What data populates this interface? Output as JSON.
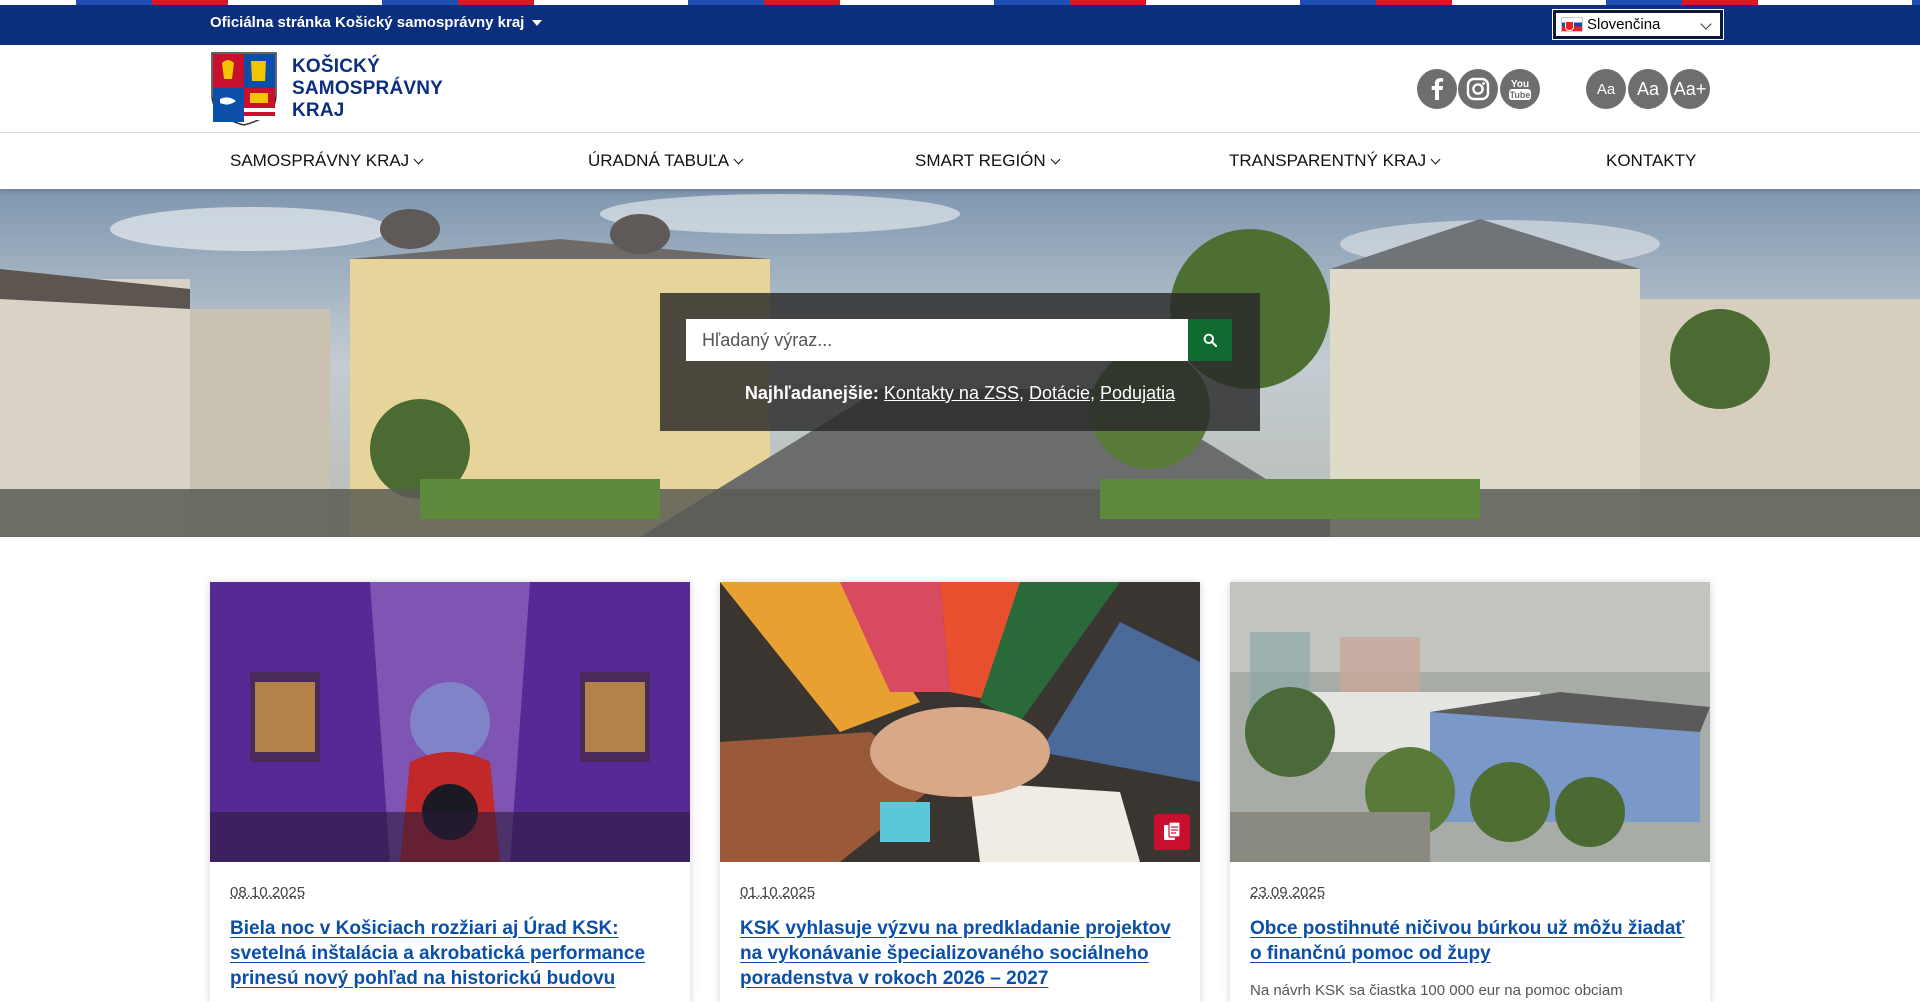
{
  "topbar": {
    "official_label": "Oficiálna stránka Košický samosprávny kraj",
    "language": "Slovenčina"
  },
  "header": {
    "logo_line1": "KOŠICKÝ",
    "logo_line2": "SAMOSPRÁVNY",
    "logo_line3": "KRAJ",
    "social": [
      "facebook-icon",
      "instagram-icon",
      "youtube-icon"
    ],
    "font_small": "Aa",
    "font_normal": "Aa",
    "font_large": "Aa+"
  },
  "nav": {
    "items": [
      {
        "label": "SAMOSPRÁVNY KRAJ",
        "has_dropdown": true
      },
      {
        "label": "ÚRADNÁ TABUĽA",
        "has_dropdown": true
      },
      {
        "label": "SMART REGIÓN",
        "has_dropdown": true
      },
      {
        "label": "TRANSPARENTNÝ KRAJ",
        "has_dropdown": true
      },
      {
        "label": "KONTAKTY",
        "has_dropdown": false
      }
    ]
  },
  "search": {
    "placeholder": "Hľadaný výraz...",
    "popular_label": "Najhľadanejšie:",
    "links": [
      "Kontakty na ZSS",
      "Dotácie",
      "Podujatia"
    ]
  },
  "news": [
    {
      "date": "08.10.2025",
      "title": "Biela noc v Košiciach rozžiari aj Úrad KSK: svetelná inštalácia a akrobatická performance prinesú nový pohľad na historickú budovu",
      "teaser": ""
    },
    {
      "date": "01.10.2025",
      "title": "KSK vyhlasuje výzvu na predkladanie projektov na vykonávanie špecializovaného sociálneho poradenstva v rokoch 2026 – 2027",
      "teaser": ""
    },
    {
      "date": "23.09.2025",
      "title": "Obce postihnuté ničivou búrkou už môžu žiadať o finančnú pomoc od župy",
      "teaser": "Na návrh KSK sa čiastka 100 000 eur na pomoc obciam"
    }
  ],
  "colors": {
    "brand_blue": "#0b2f7e",
    "link_blue": "#0b4fa8",
    "search_green": "#0f6b2f",
    "badge_red": "#c8102e",
    "icon_gray": "#6e6e6e"
  }
}
